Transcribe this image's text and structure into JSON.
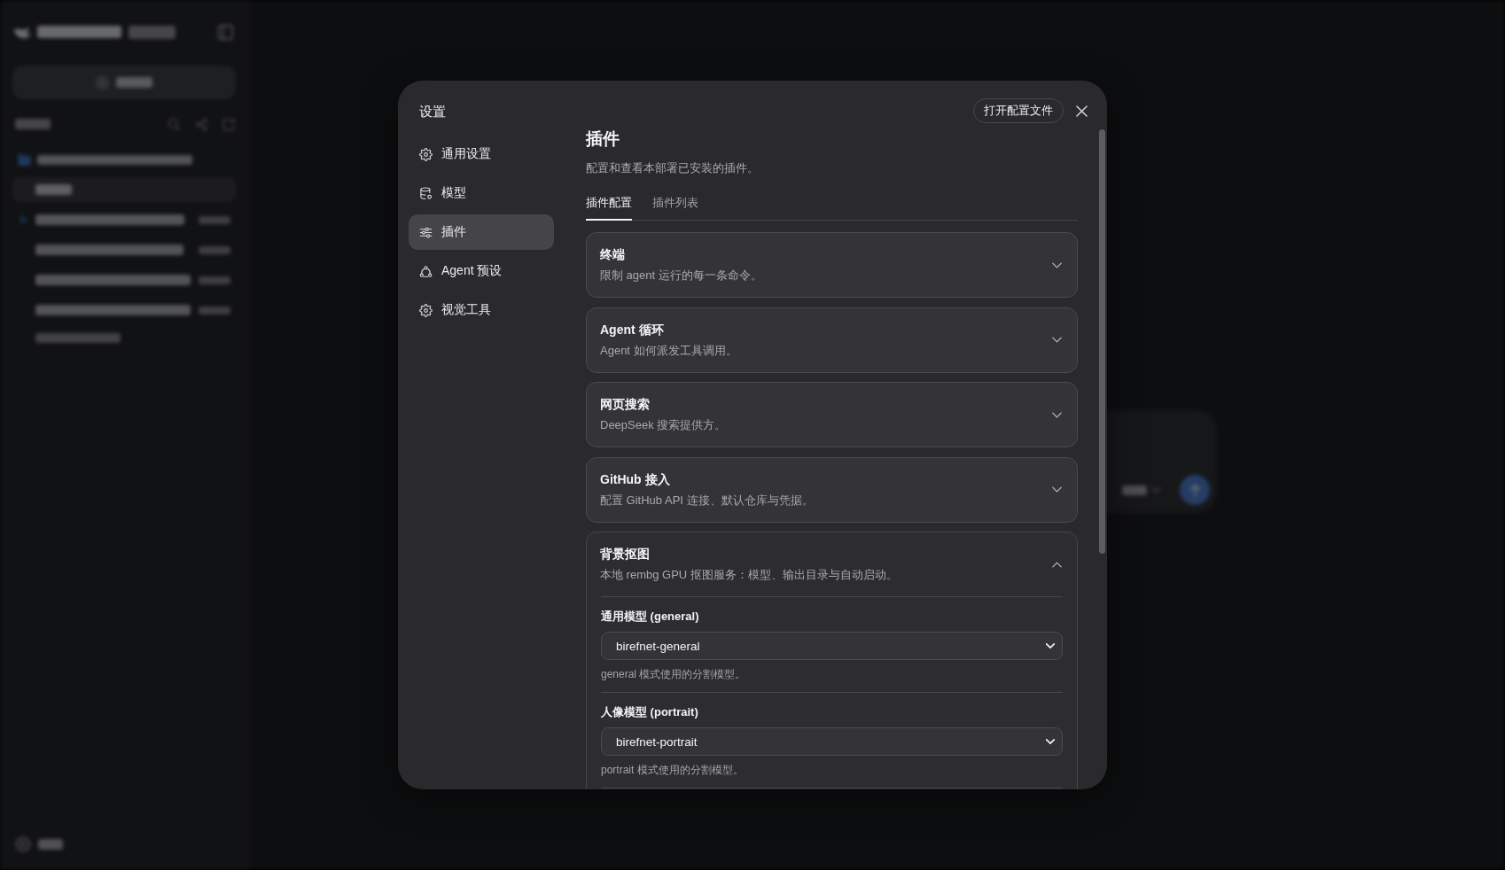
{
  "background": {
    "sidebar": {
      "sessions": [
        {
          "selected": true,
          "unread": false
        },
        {
          "selected": false,
          "unread": true
        },
        {
          "selected": false,
          "unread": false
        },
        {
          "selected": false,
          "unread": false
        },
        {
          "selected": false,
          "unread": false
        }
      ]
    }
  },
  "settings_dialog": {
    "title": "设置",
    "open_config_button": "打开配置文件",
    "nav": [
      {
        "label": "通用设置",
        "selected": false
      },
      {
        "label": "模型",
        "selected": false
      },
      {
        "label": "插件",
        "selected": true
      },
      {
        "label": "Agent 预设",
        "selected": false
      },
      {
        "label": "视觉工具",
        "selected": false
      }
    ],
    "page": {
      "title": "插件",
      "description": "配置和查看本部署已安装的插件。",
      "tabs": [
        {
          "label": "插件配置",
          "selected": true
        },
        {
          "label": "插件列表",
          "selected": false
        }
      ],
      "plugins": [
        {
          "title": "终端",
          "description": "限制 agent 运行的每一条命令。",
          "expanded": false
        },
        {
          "title": "Agent 循环",
          "description": "Agent 如何派发工具调用。",
          "expanded": false
        },
        {
          "title": "网页搜索",
          "description": "DeepSeek 搜索提供方。",
          "expanded": false
        },
        {
          "title": "GitHub 接入",
          "description": "配置 GitHub API 连接、默认仓库与凭据。",
          "expanded": false
        },
        {
          "title": "背景抠图",
          "description": "本地 rembg GPU 抠图服务：模型、输出目录与自动启动。",
          "expanded": true,
          "fields": [
            {
              "label": "通用模型 (general)",
              "value": "birefnet-general",
              "help": "general 模式使用的分割模型。"
            },
            {
              "label": "人像模型 (portrait)",
              "value": "birefnet-portrait",
              "help": "portrait 模式使用的分割模型。"
            }
          ]
        }
      ]
    }
  }
}
